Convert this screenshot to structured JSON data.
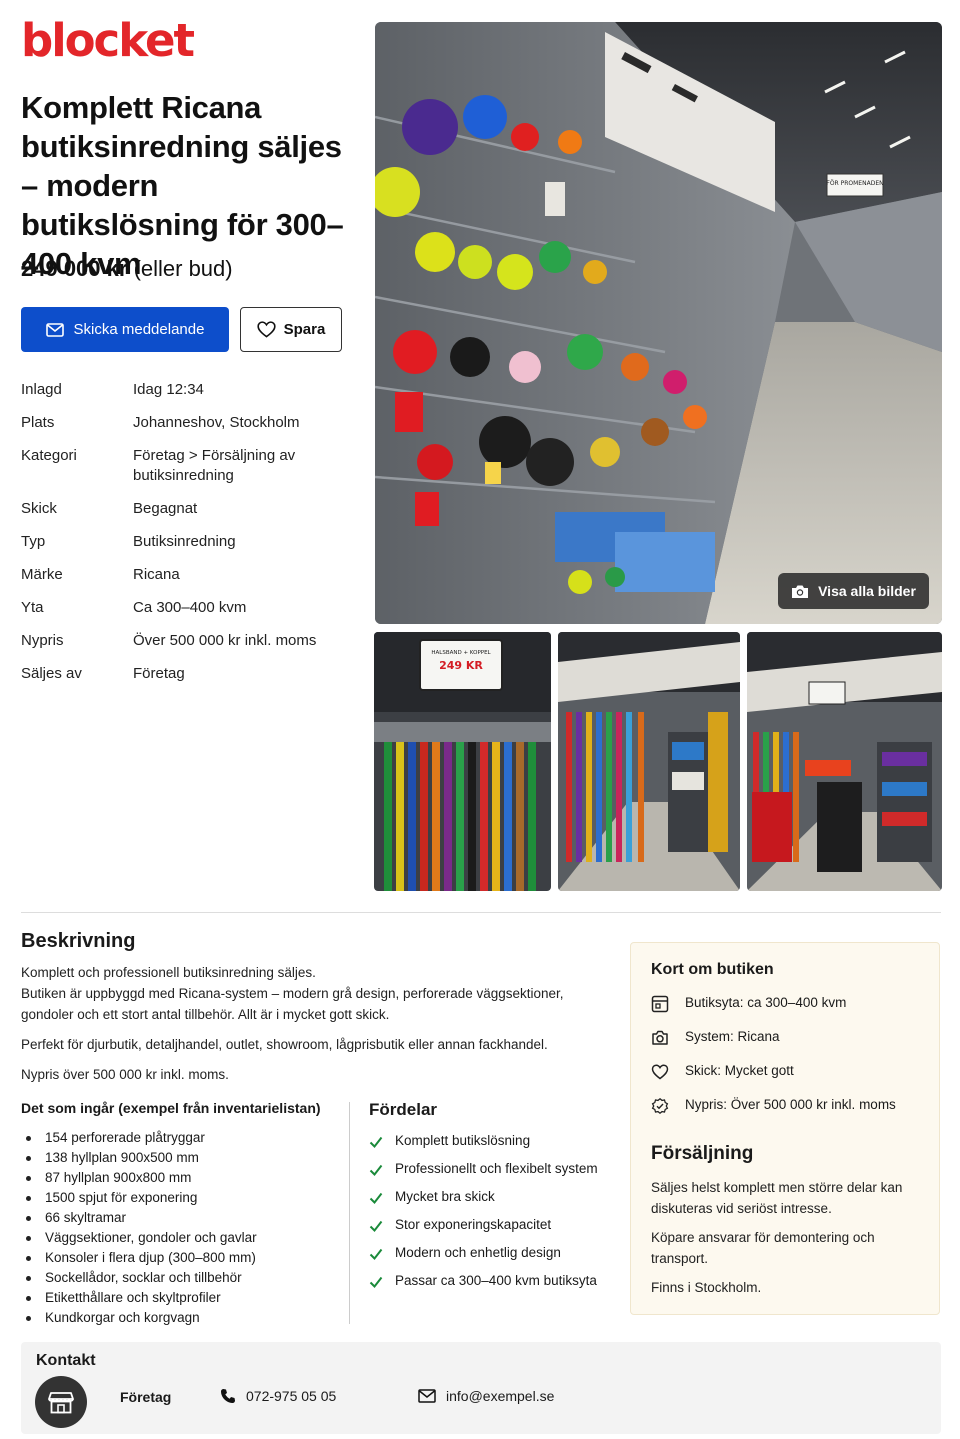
{
  "brand": {
    "logo": "blocket"
  },
  "listing": {
    "title": "Komplett Ricana butiksinredning säljes – modern butikslösning för 300–400 kvm",
    "price": "249 000 kr",
    "price_suffix": "(eller bud)"
  },
  "actions": {
    "message_label": "Skicka meddelande",
    "save_label": "Spara"
  },
  "details": [
    {
      "label": "Inlagd",
      "value": "Idag 12:34"
    },
    {
      "label": "Plats",
      "value": "Johanneshov, Stockholm"
    },
    {
      "label": "Kategori",
      "value": "Företag > Försäljning av butiksinredning"
    },
    {
      "label": "Skick",
      "value": "Begagnat"
    },
    {
      "label": "Typ",
      "value": "Butiksinredning"
    },
    {
      "label": "Märke",
      "value": "Ricana"
    },
    {
      "label": "Yta",
      "value": "Ca 300–400 kvm"
    },
    {
      "label": "Nypris",
      "value": "Över 500 000 kr inkl. moms"
    },
    {
      "label": "Säljes av",
      "value": "Företag"
    }
  ],
  "gallery": {
    "show_all_label": "Visa alla bilder",
    "main_sign": "FÖR PROMENADEN",
    "thumb_sign_top": "HALSBAND + KOPPEL",
    "thumb_sign_price": "249 KR"
  },
  "description": {
    "heading": "Beskrivning",
    "paragraphs": [
      "Komplett och professionell butiksinredning säljes.\nButiken är uppbyggd med Ricana-system – modern grå design, perforerade väggsektioner, gondoler och ett stort antal tillbehör. Allt är i mycket gott skick.",
      "Perfekt för djurbutik, detaljhandel, outlet, showroom, lågprisbutik eller annan fackhandel.",
      "Nypris över 500 000 kr inkl. moms."
    ]
  },
  "included": {
    "heading": "Det som ingår (exempel från inventarielistan)",
    "items": [
      "154 perforerade plåtryggar",
      "138 hyllplan 900x500 mm",
      "87 hyllplan 900x800 mm",
      "1500 spjut för exponering",
      "66 skyltramar",
      "Väggsektioner, gondoler och gavlar",
      "Konsoler i flera djup (300–800 mm)",
      "Sockellådor, socklar och tillbehör",
      "Etiketthållare och skyltprofiler",
      "Kundkorgar och korgvagn"
    ]
  },
  "advantages": {
    "heading": "Fördelar",
    "items": [
      "Komplett butikslösning",
      "Professionellt och flexibelt system",
      "Mycket bra skick",
      "Stor exponeringskapacitet",
      "Modern och enhetlig design",
      "Passar ca 300–400 kvm butiksyta"
    ]
  },
  "summary": {
    "heading": "Kort om butiken",
    "items": [
      {
        "icon": "floorplan-icon",
        "text": "Butiksyta: ca 300–400 kvm"
      },
      {
        "icon": "camera-icon",
        "text": "System: Ricana"
      },
      {
        "icon": "heart-icon",
        "text": "Skick: Mycket gott"
      },
      {
        "icon": "price-tag-icon",
        "text": "Nypris: Över 500 000 kr inkl. moms"
      }
    ]
  },
  "sale": {
    "heading": "Försäljning",
    "paragraphs": [
      "Säljes helst komplett men större delar kan diskuteras vid seriöst intresse.",
      "Köpare ansvarar för demontering och transport.",
      "Finns i Stockholm."
    ]
  },
  "contact": {
    "heading": "Kontakt",
    "company": "Företag",
    "phone": "072-975 05 05",
    "email": "info@exempel.se"
  },
  "colors": {
    "brand_red": "#e3262a",
    "primary_blue": "#0d4ecb",
    "check_green": "#1a8a3a",
    "card_bg": "#fdf9ef"
  }
}
